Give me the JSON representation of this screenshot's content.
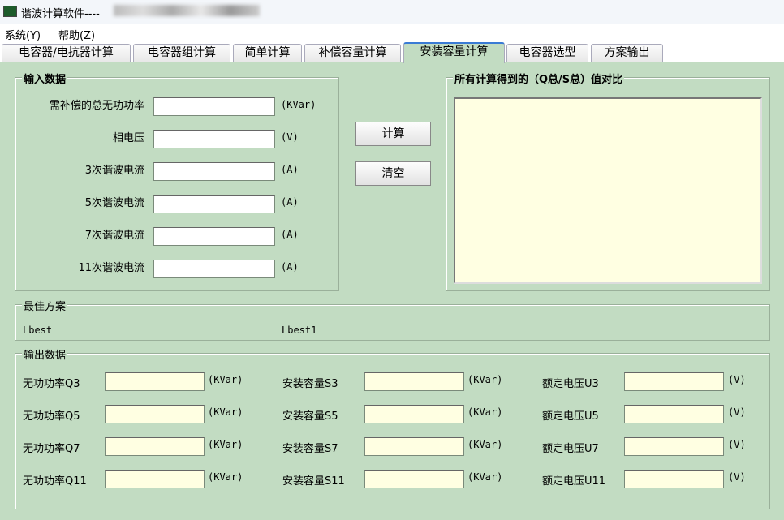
{
  "window": {
    "title": "谐波计算软件----"
  },
  "menu": [
    {
      "label": "系统(Y)"
    },
    {
      "label": "帮助(Z)"
    }
  ],
  "tabs": [
    {
      "label": "电容器/电抗器计算"
    },
    {
      "label": "电容器组计算"
    },
    {
      "label": "简单计算"
    },
    {
      "label": "补偿容量计算"
    },
    {
      "label": "安装容量计算",
      "active": true
    },
    {
      "label": "电容器选型"
    },
    {
      "label": "方案输出"
    }
  ],
  "input_group": {
    "title": "输入数据",
    "fields": [
      {
        "label": "需补偿的总无功功率",
        "value": "",
        "unit": "(KVar)"
      },
      {
        "label": "相电压",
        "value": "",
        "unit": "(V)"
      },
      {
        "label": "3次谐波电流",
        "value": "",
        "unit": "(A)"
      },
      {
        "label": "5次谐波电流",
        "value": "",
        "unit": "(A)"
      },
      {
        "label": "7次谐波电流",
        "value": "",
        "unit": "(A)"
      },
      {
        "label": "11次谐波电流",
        "value": "",
        "unit": "(A)"
      }
    ]
  },
  "buttons": {
    "calculate": "计算",
    "clear": "清空"
  },
  "compare_group": {
    "title": "所有计算得到的（Q总/S总）值对比",
    "content": ""
  },
  "best_group": {
    "title": "最佳方案",
    "lbest": "Lbest",
    "lbest1": "Lbest1"
  },
  "output_group": {
    "title": "输出数据",
    "rows": [
      {
        "q_label": "无功功率Q3",
        "q_unit": "(KVar)",
        "s_label": "安装容量S3",
        "s_unit": "(KVar)",
        "u_label": "额定电压U3",
        "u_unit": "(V)"
      },
      {
        "q_label": "无功功率Q5",
        "q_unit": "(KVar)",
        "s_label": "安装容量S5",
        "s_unit": "(KVar)",
        "u_label": "额定电压U5",
        "u_unit": "(V)"
      },
      {
        "q_label": "无功功率Q7",
        "q_unit": "(KVar)",
        "s_label": "安装容量S7",
        "s_unit": "(KVar)",
        "u_label": "额定电压U7",
        "u_unit": "(V)"
      },
      {
        "q_label": "无功功率Q11",
        "q_unit": "(KVar)",
        "s_label": "安装容量S11",
        "s_unit": "(KVar)",
        "u_label": "额定电压U11",
        "u_unit": "(V)"
      }
    ]
  }
}
